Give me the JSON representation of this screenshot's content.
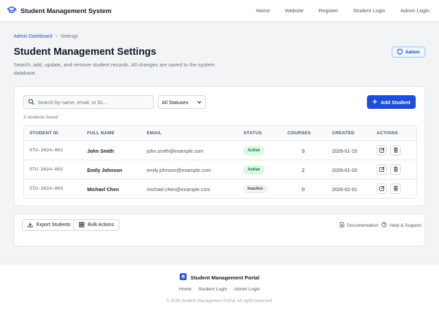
{
  "header": {
    "brand": "Student Management System",
    "nav": [
      "Home",
      "Website",
      "Register",
      "Student Login",
      "Admin Login"
    ]
  },
  "breadcrumb": {
    "parent": "Admin Dashboard",
    "separator": "›",
    "current": "Settings"
  },
  "page": {
    "title": "Student Management Settings",
    "description": "Search, add, update, and remove student records. All changes are saved to the system database.",
    "role_badge": "Admin"
  },
  "toolbar": {
    "search_placeholder": "Search by name, email, or ID...",
    "status_filter": "All Statuses",
    "add_label": "Add Student"
  },
  "results_count": "3 students found",
  "table": {
    "columns": [
      "STUDENT ID",
      "FULL NAME",
      "EMAIL",
      "STATUS",
      "COURSES",
      "CREATED",
      "ACTIONS"
    ],
    "rows": [
      {
        "id": "STU-2024-001",
        "name": "John Smith",
        "email": "john.smith@example.com",
        "status": "Active",
        "courses": "3",
        "created": "2026-01-15"
      },
      {
        "id": "STU-2024-002",
        "name": "Emily Johnson",
        "email": "emily.johnson@example.com",
        "status": "Active",
        "courses": "2",
        "created": "2026-01-20"
      },
      {
        "id": "STU-2024-003",
        "name": "Michael Chen",
        "email": "michael.chen@example.com",
        "status": "Inactive",
        "courses": "0",
        "created": "2026-02-01"
      }
    ]
  },
  "footer_actions": {
    "export_label": "Export Students",
    "bulk_label": "Bulk Actions",
    "docs_label": "Documentation",
    "help_label": "Help & Support"
  },
  "page_footer": {
    "brand": "Student Management Portal",
    "links": [
      "Home",
      "Student Login",
      "Admin Login"
    ],
    "copyright": "© 2026 Student Management Portal. All rights reserved."
  },
  "colors": {
    "accent": "#1d4ed8",
    "active_bg": "#dcfce7",
    "active_text": "#166534"
  }
}
